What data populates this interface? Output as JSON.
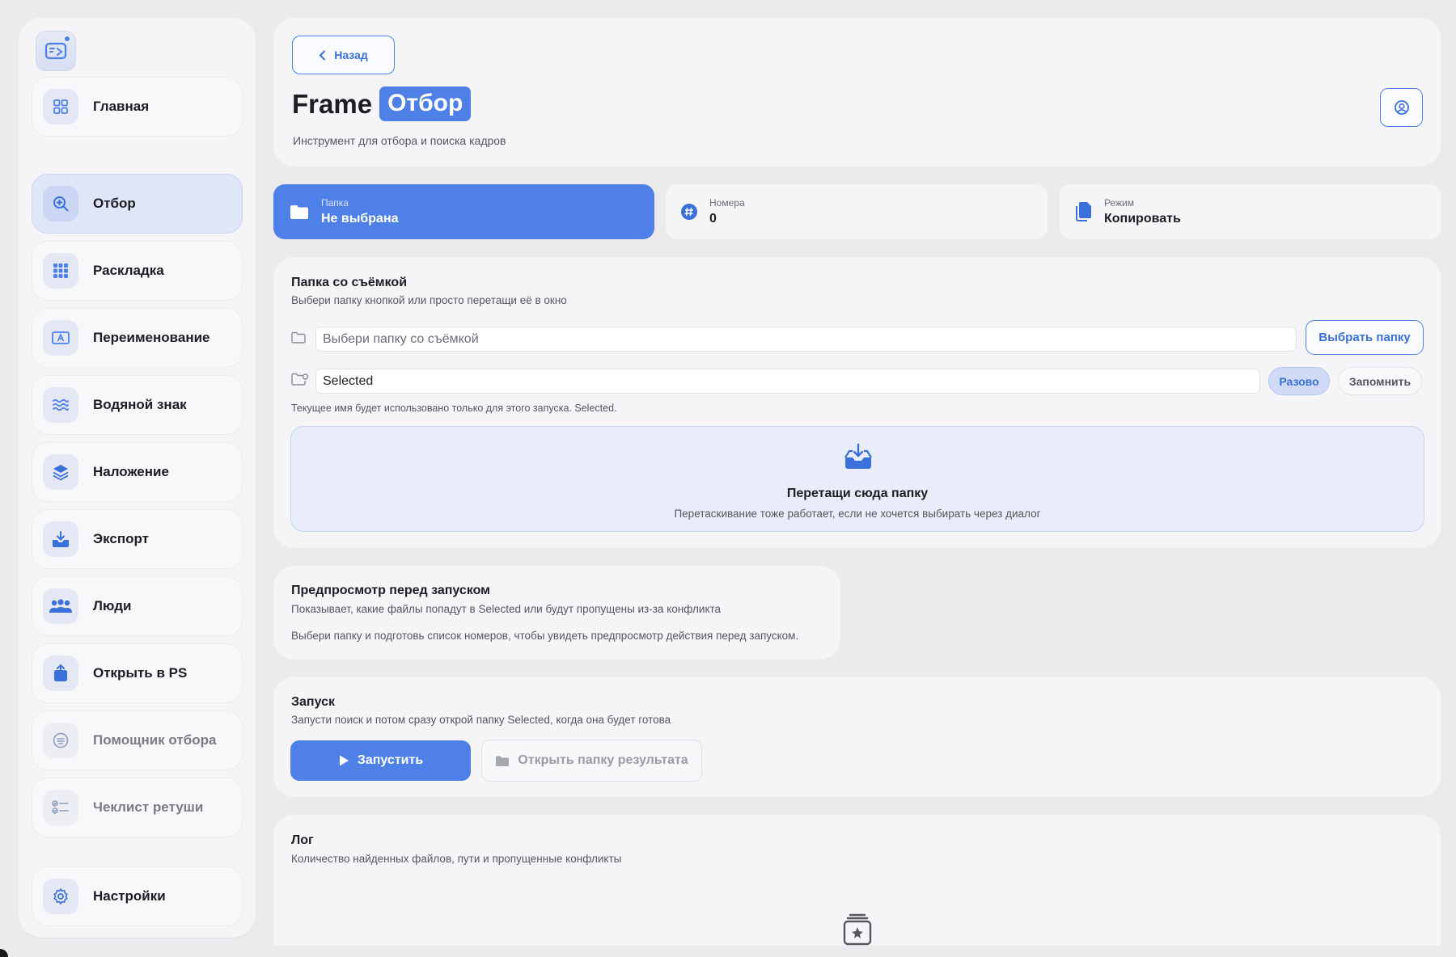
{
  "sidebar": {
    "items": [
      {
        "label": "Главная",
        "icon": "grid-icon"
      },
      {
        "label": "Отбор",
        "icon": "search-icon",
        "active": true
      },
      {
        "label": "Раскладка",
        "icon": "layout-grid-icon"
      },
      {
        "label": "Переименование",
        "icon": "rename-icon"
      },
      {
        "label": "Водяной знак",
        "icon": "watermark-icon"
      },
      {
        "label": "Наложение",
        "icon": "layers-icon"
      },
      {
        "label": "Экспорт",
        "icon": "export-icon"
      },
      {
        "label": "Люди",
        "icon": "people-icon"
      },
      {
        "label": "Открыть в PS",
        "icon": "open-ps-icon"
      },
      {
        "label": "Помощник отбора",
        "icon": "assistant-icon",
        "disabled": true
      },
      {
        "label": "Чеклист ретуши",
        "icon": "checklist-icon",
        "disabled": true
      },
      {
        "label": "Настройки",
        "icon": "gear-icon"
      }
    ]
  },
  "header": {
    "back_label": "Назад",
    "title_plain": "Frame",
    "title_highlight": "Отбор",
    "subtitle": "Инструмент для отбора и поиска кадров"
  },
  "stats": {
    "folder": {
      "label": "Папка",
      "value": "Не выбрана"
    },
    "numbers": {
      "label": "Номера",
      "value": "0"
    },
    "mode": {
      "label": "Режим",
      "value": "Копировать"
    }
  },
  "folder_section": {
    "title": "Папка со съёмкой",
    "subtitle": "Выбери папку кнопкой или просто перетащи её в окно",
    "folder_placeholder": "Выбери папку со съёмкой",
    "pick_button": "Выбрать папку",
    "output_name": "Selected",
    "once_label": "Разово",
    "remember_label": "Запомнить",
    "hint": "Текущее имя будет использовано только для этого запуска. Selected.",
    "drop_title": "Перетащи сюда папку",
    "drop_subtitle": "Перетаскивание тоже работает, если не хочется выбирать через диалог"
  },
  "preview_section": {
    "title": "Предпросмотр перед запуском",
    "subtitle": "Показывает, какие файлы попадут в Selected или будут пропущены из-за конфликта",
    "empty_text": "Выбери папку и подготовь список номеров, чтобы увидеть предпросмотр действия перед запуском."
  },
  "run_section": {
    "title": "Запуск",
    "subtitle": "Запусти поиск и потом сразу открой папку Selected, когда она будет готова",
    "run_label": "Запустить",
    "open_label": "Открыть папку результата"
  },
  "log_section": {
    "title": "Лог",
    "subtitle": "Количество найденных файлов, пути и пропущенные конфликты"
  },
  "colors": {
    "accent": "#4f80e8",
    "background": "#ebebee",
    "card": "#f5f5f8"
  }
}
